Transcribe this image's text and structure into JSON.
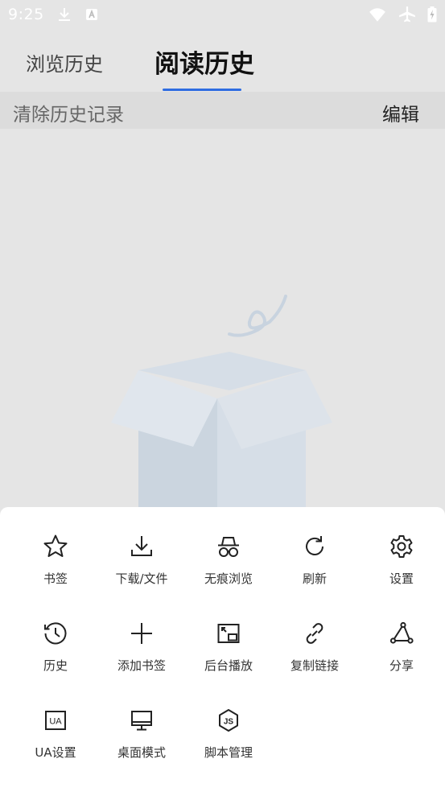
{
  "status_bar": {
    "time": "9:25",
    "left_icons": [
      "download-icon",
      "app-store-icon"
    ],
    "right_icons": [
      "wifi-icon",
      "airplane-mode-icon",
      "battery-charging-icon"
    ]
  },
  "tabs": [
    {
      "label": "浏览历史",
      "active": false
    },
    {
      "label": "阅读历史",
      "active": true
    }
  ],
  "toolbar": {
    "clear_label": "清除历史记录",
    "edit_label": "编辑"
  },
  "empty_state": {
    "illustration": "empty-box-illustration"
  },
  "menu": {
    "rows": [
      [
        {
          "label": "书签",
          "icon": "star-icon"
        },
        {
          "label": "下载/文件",
          "icon": "download-tray-icon"
        },
        {
          "label": "无痕浏览",
          "icon": "incognito-icon"
        },
        {
          "label": "刷新",
          "icon": "refresh-icon"
        },
        {
          "label": "设置",
          "icon": "gear-icon"
        }
      ],
      [
        {
          "label": "历史",
          "icon": "history-clock-icon"
        },
        {
          "label": "添加书签",
          "icon": "plus-icon"
        },
        {
          "label": "后台播放",
          "icon": "picture-in-picture-icon"
        },
        {
          "label": "复制链接",
          "icon": "link-icon"
        },
        {
          "label": "分享",
          "icon": "share-icon"
        }
      ],
      [
        {
          "label": "UA设置",
          "icon": "ua-icon"
        },
        {
          "label": "桌面模式",
          "icon": "desktop-icon"
        },
        {
          "label": "脚本管理",
          "icon": "js-script-icon"
        }
      ]
    ]
  },
  "colors": {
    "accent": "#2f6de1",
    "page_bg": "#e5e5e5",
    "toolbar_bg": "#dcdcdc",
    "sheet_bg": "#ffffff"
  }
}
